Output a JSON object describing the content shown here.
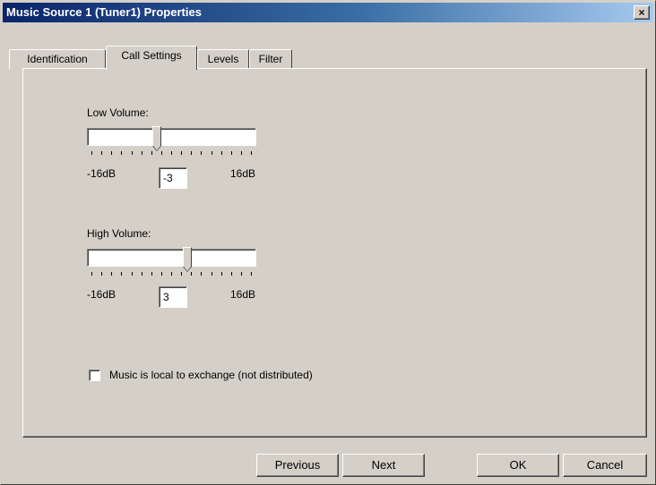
{
  "window": {
    "title": "Music Source 1 (Tuner1) Properties",
    "close_label": "×"
  },
  "tabs": [
    {
      "label": "Identification"
    },
    {
      "label": "Call Settings"
    },
    {
      "label": "Levels"
    },
    {
      "label": "Filter"
    }
  ],
  "active_tab": "Call Settings",
  "low_volume": {
    "label": "Low Volume:",
    "min_label": "-16dB",
    "max_label": "16dB",
    "min": -16,
    "max": 16,
    "value": "-3"
  },
  "high_volume": {
    "label": "High Volume:",
    "min_label": "-16dB",
    "max_label": "16dB",
    "min": -16,
    "max": 16,
    "value": "3"
  },
  "local_music": {
    "label": "Music is local to exchange (not distributed)",
    "checked": false
  },
  "buttons": {
    "previous": "Previous",
    "next": "Next",
    "ok": "OK",
    "cancel": "Cancel"
  }
}
